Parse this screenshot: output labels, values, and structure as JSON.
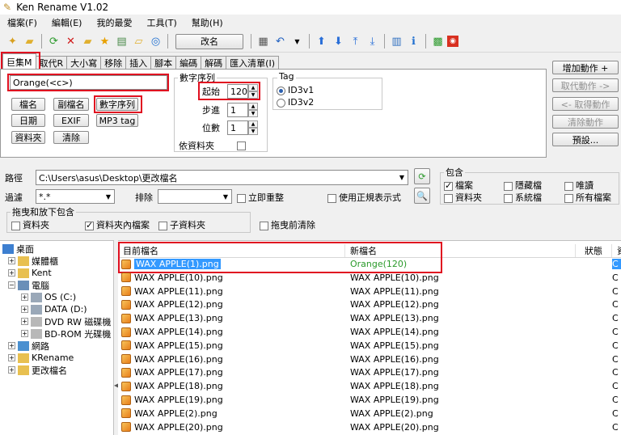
{
  "title": "Ken Rename V1.02",
  "menu": [
    "檔案(F)",
    "編輯(E)",
    "我的最愛",
    "工具(T)",
    "幫助(H)"
  ],
  "toolbar": {
    "rename_label": "改名"
  },
  "tabs": [
    "巨集M",
    "取代R",
    "大小寫",
    "移除",
    "插入",
    "腳本",
    "編碼",
    "解碼",
    "匯入清單(I)"
  ],
  "macro": {
    "pattern": "Orange(<c>)",
    "buttons": [
      "檔名",
      "副檔名",
      "數字序列",
      "日期",
      "EXIF",
      "MP3 tag",
      "資料夾",
      "清除"
    ]
  },
  "sequence": {
    "group_title": "數字序列",
    "start_label": "起始",
    "start_value": "120",
    "step_label": "步進",
    "step_value": "1",
    "digits_label": "位數",
    "digits_value": "1",
    "by_folder_label": "依資料夾"
  },
  "tag": {
    "group_title": "Tag",
    "options": [
      "ID3v1",
      "ID3v2"
    ]
  },
  "actions": [
    "增加動作 +",
    "取代動作 ->",
    "<- 取得動作",
    "清除動作",
    "預設..."
  ],
  "path": {
    "label": "路徑",
    "value": "C:\\Users\\asus\\Desktop\\更改檔名"
  },
  "filter": {
    "label": "過濾",
    "value": "*.*",
    "exclude_label": "排除",
    "refresh_label": "立即重整",
    "regex_label": "使用正規表示式"
  },
  "include": {
    "title": "包含",
    "items": [
      "檔案",
      "隱藏檔",
      "唯讀",
      "資料夾",
      "系統檔",
      "所有檔案"
    ]
  },
  "drag": {
    "title": "拖曳和放下包含",
    "items": [
      "資料夾",
      "資料夾內檔案",
      "子資料夾"
    ],
    "clear_label": "拖曳前清除"
  },
  "tree": [
    "桌面",
    "媒體櫃",
    "Kent",
    "電腦",
    "OS (C:)",
    "DATA (D:)",
    "DVD RW 磁碟機",
    "BD-ROM 光碟機",
    "網路",
    "KRename",
    "更改檔名"
  ],
  "columns": {
    "current": "目前檔名",
    "new": "新檔名",
    "status": "狀態",
    "extra": "資"
  },
  "files": [
    [
      "WAX APPLE(1).png",
      "Orange(120)"
    ],
    [
      "WAX APPLE(10).png",
      "WAX APPLE(10).png"
    ],
    [
      "WAX APPLE(11).png",
      "WAX APPLE(11).png"
    ],
    [
      "WAX APPLE(12).png",
      "WAX APPLE(12).png"
    ],
    [
      "WAX APPLE(13).png",
      "WAX APPLE(13).png"
    ],
    [
      "WAX APPLE(14).png",
      "WAX APPLE(14).png"
    ],
    [
      "WAX APPLE(15).png",
      "WAX APPLE(15).png"
    ],
    [
      "WAX APPLE(16).png",
      "WAX APPLE(16).png"
    ],
    [
      "WAX APPLE(17).png",
      "WAX APPLE(17).png"
    ],
    [
      "WAX APPLE(18).png",
      "WAX APPLE(18).png"
    ],
    [
      "WAX APPLE(19).png",
      "WAX APPLE(19).png"
    ],
    [
      "WAX APPLE(2).png",
      "WAX APPLE(2).png"
    ],
    [
      "WAX APPLE(20).png",
      "WAX APPLE(20).png"
    ]
  ],
  "status_col_char": "C"
}
